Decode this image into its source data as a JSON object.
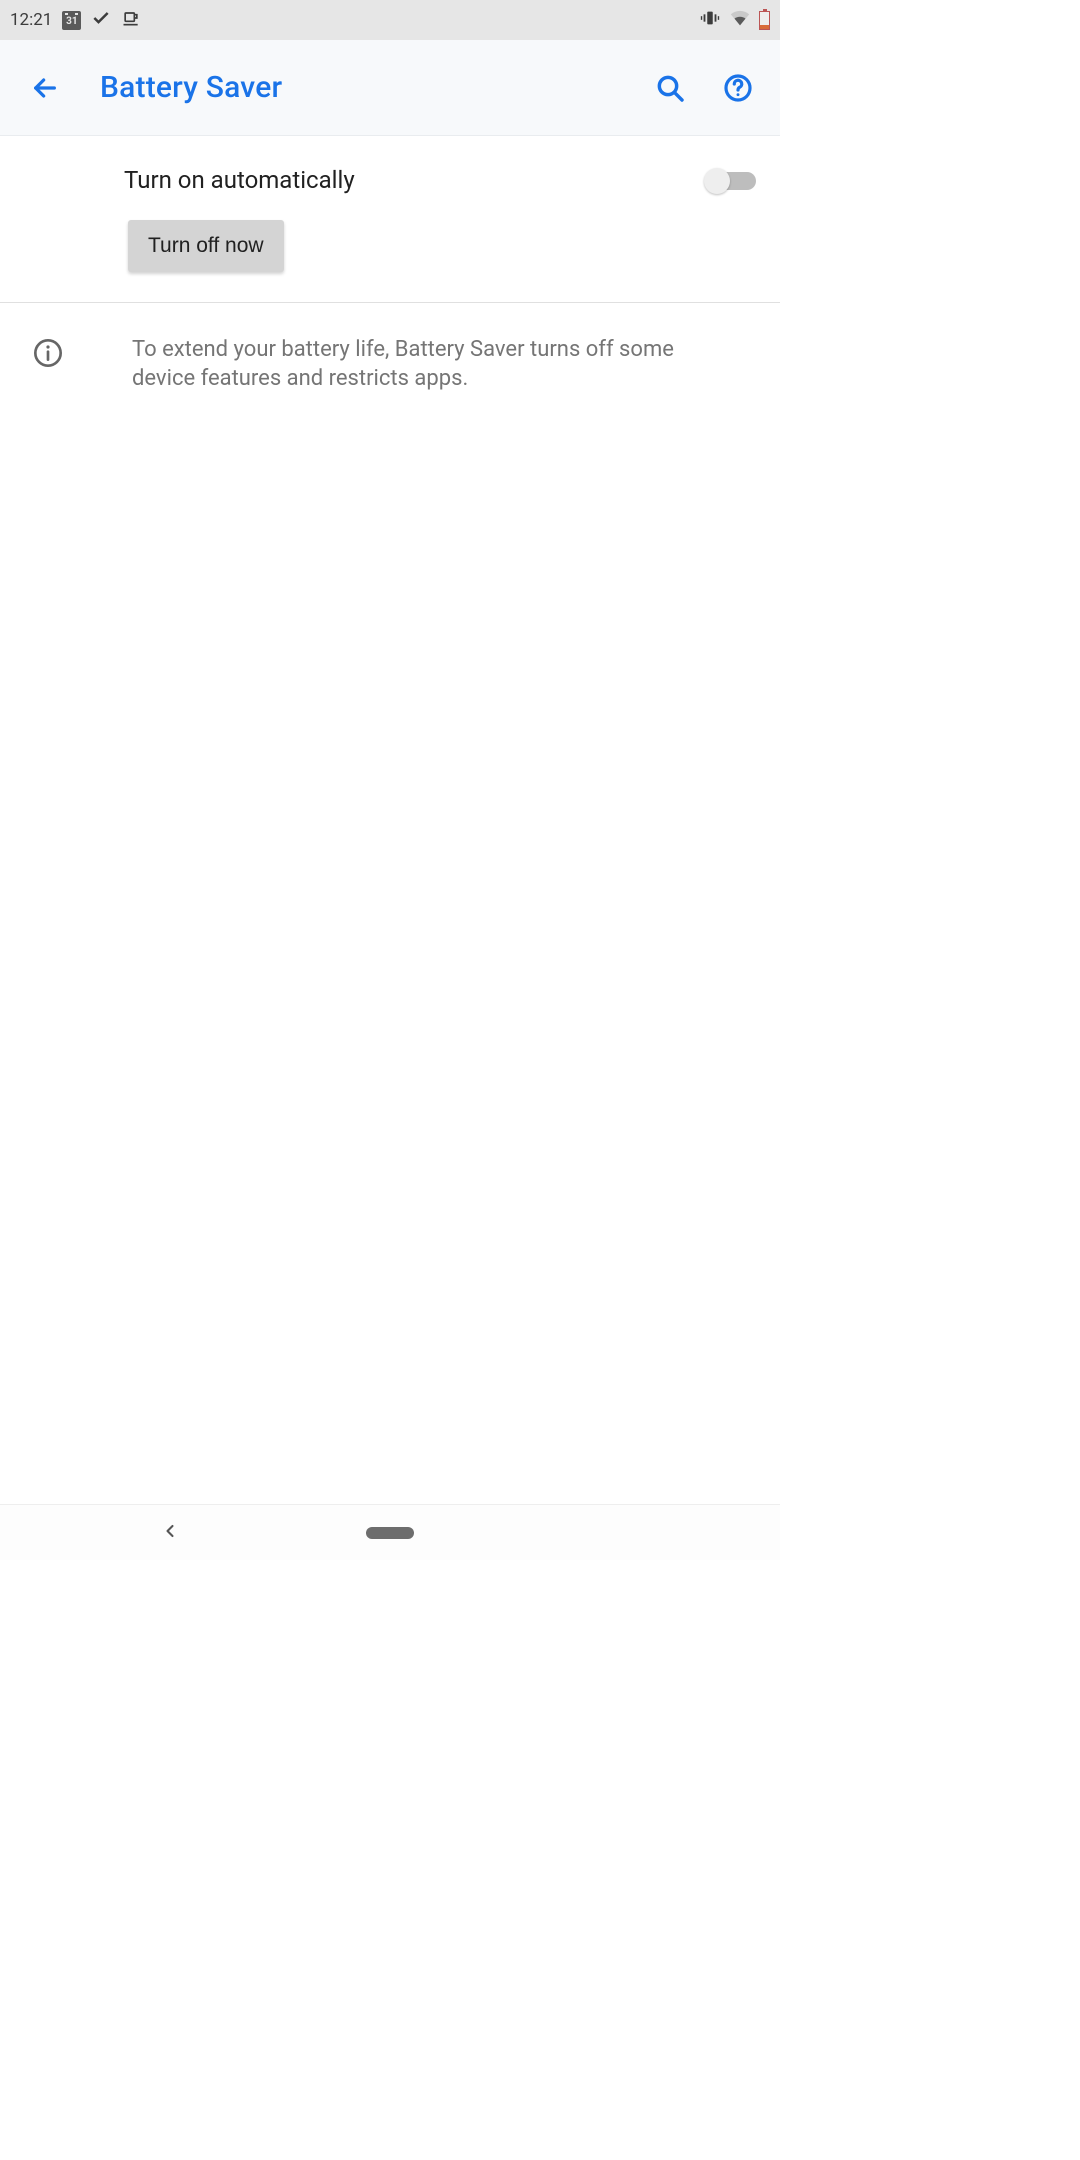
{
  "status_bar": {
    "time": "12:21",
    "calendar_day": "31"
  },
  "app_bar": {
    "title": "Battery Saver"
  },
  "settings": {
    "auto_on_label": "Turn on automatically",
    "auto_on_enabled": false,
    "turn_off_button": "Turn off now"
  },
  "info": {
    "text": "To extend your battery life, Battery Saver turns off some device features and restricts apps."
  },
  "colors": {
    "accent": "#1a73e8"
  }
}
